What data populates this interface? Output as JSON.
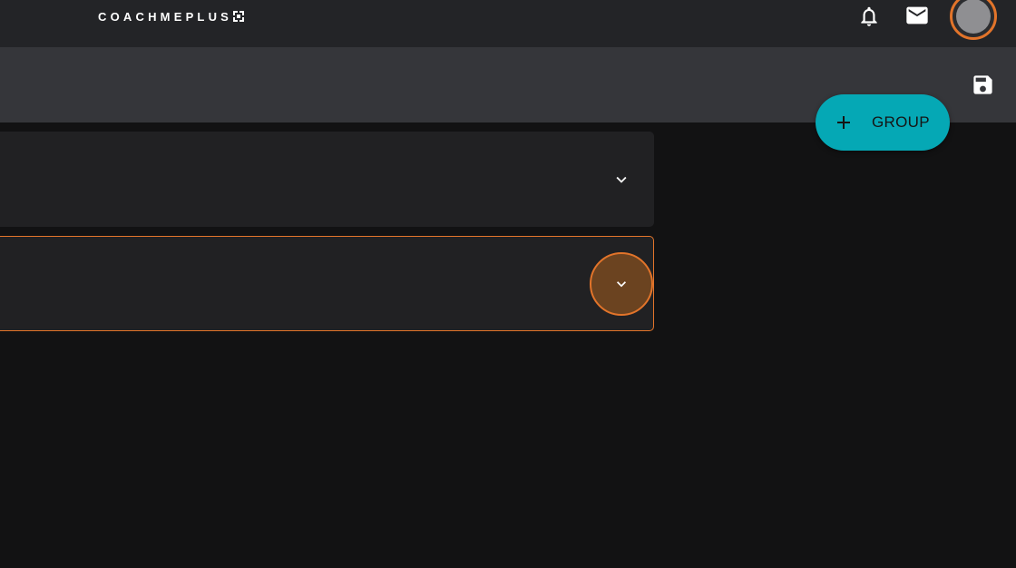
{
  "header": {
    "logo_text": "COACHMEPLUS",
    "notifications_icon": "bell-icon",
    "messages_icon": "mail-icon",
    "avatar_icon": "user-avatar"
  },
  "toolbar": {
    "save_icon": "save-icon"
  },
  "fab": {
    "label": "GROUP",
    "icon": "plus-icon",
    "color": "#05a8b5"
  },
  "panels": [
    {
      "expanded": false,
      "active": false,
      "icon": "chevron-down-icon"
    },
    {
      "expanded": false,
      "active": true,
      "icon": "chevron-down-icon",
      "accent": "#e2742a"
    }
  ],
  "colors": {
    "accent": "#e2742a",
    "background": "#121213",
    "topbar": "#232427",
    "subbar": "#35363a"
  }
}
